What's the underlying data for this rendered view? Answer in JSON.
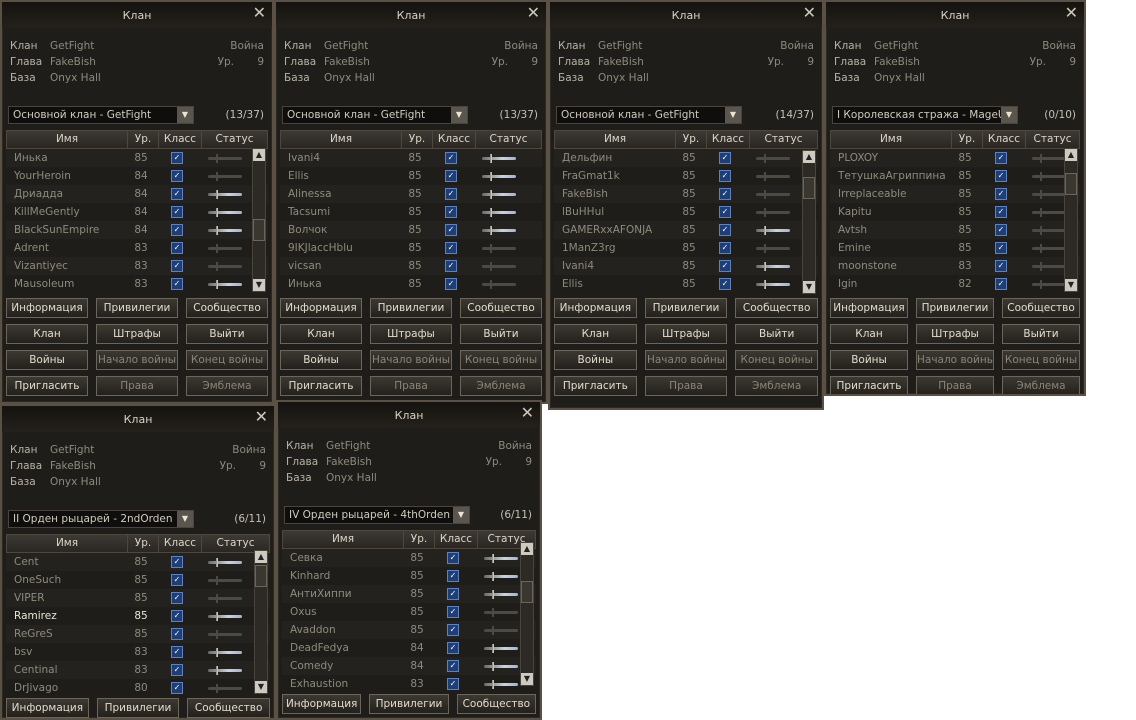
{
  "panels": [
    {
      "title": "Клан",
      "info": {
        "clan_k": "Клан",
        "clan_v": "GetFight",
        "war": "Война",
        "leader_k": "Глава",
        "leader_v": "FakeBish",
        "lvl_k": "Ур.",
        "lvl_v": "9",
        "base_k": "База",
        "base_v": "Onyx Hall"
      },
      "select": "Основной клан - GetFight",
      "count": "(13/37)",
      "headers": [
        "Имя",
        "Ур.",
        "Класс",
        "Статус"
      ],
      "rows": [
        {
          "name": "Инька",
          "lvl": "85",
          "on": false
        },
        {
          "name": "YourHeroin",
          "lvl": "84",
          "on": false
        },
        {
          "name": "Дриадда",
          "lvl": "84",
          "on": true
        },
        {
          "name": "KillMeGently",
          "lvl": "84",
          "on": true
        },
        {
          "name": "BlackSunEmpire",
          "lvl": "84",
          "on": true
        },
        {
          "name": "Adrent",
          "lvl": "83",
          "on": false
        },
        {
          "name": "Vizantiyec",
          "lvl": "83",
          "on": false
        },
        {
          "name": "Mausoleum",
          "lvl": "83",
          "on": true
        }
      ],
      "buttons": [
        {
          "label": "Информация",
          "dis": false
        },
        {
          "label": "Привилегии",
          "dis": false
        },
        {
          "label": "Сообщество",
          "dis": false
        },
        {
          "label": "Клан",
          "dis": false
        },
        {
          "label": "Штрафы",
          "dis": false
        },
        {
          "label": "Выйти",
          "dis": false
        },
        {
          "label": "Войны",
          "dis": false
        },
        {
          "label": "Начало войны",
          "dis": true
        },
        {
          "label": "Конец войны",
          "dis": true
        },
        {
          "label": "Пригласить",
          "dis": false
        },
        {
          "label": "Права",
          "dis": true
        },
        {
          "label": "Эмблема",
          "dis": true
        }
      ]
    },
    {
      "title": "Клан",
      "info": {
        "clan_k": "Клан",
        "clan_v": "GetFight",
        "war": "Война",
        "leader_k": "Глава",
        "leader_v": "FakeBish",
        "lvl_k": "Ур.",
        "lvl_v": "9",
        "base_k": "База",
        "base_v": "Onyx Hall"
      },
      "select": "Основной клан - GetFight",
      "count": "(13/37)",
      "headers": [
        "Имя",
        "Ур.",
        "Класс",
        "Статус"
      ],
      "rows": [
        {
          "name": "Ivani4",
          "lvl": "85",
          "on": true
        },
        {
          "name": "Ellis",
          "lvl": "85",
          "on": true
        },
        {
          "name": "Alinessa",
          "lvl": "85",
          "on": true
        },
        {
          "name": "Tacsumi",
          "lvl": "85",
          "on": true
        },
        {
          "name": "Волчок",
          "lvl": "85",
          "on": true
        },
        {
          "name": "9IKJlaccHblu",
          "lvl": "85",
          "on": false
        },
        {
          "name": "vicsan",
          "lvl": "85",
          "on": false
        },
        {
          "name": "Инька",
          "lvl": "85",
          "on": false
        }
      ],
      "buttons": [
        {
          "label": "Информация",
          "dis": false
        },
        {
          "label": "Привилегии",
          "dis": false
        },
        {
          "label": "Сообщество",
          "dis": false
        },
        {
          "label": "Клан",
          "dis": false
        },
        {
          "label": "Штрафы",
          "dis": false
        },
        {
          "label": "Выйти",
          "dis": false
        },
        {
          "label": "Войны",
          "dis": false
        },
        {
          "label": "Начало войны",
          "dis": true
        },
        {
          "label": "Конец войны",
          "dis": true
        },
        {
          "label": "Пригласить",
          "dis": false
        },
        {
          "label": "Права",
          "dis": true
        },
        {
          "label": "Эмблема",
          "dis": true
        }
      ]
    },
    {
      "title": "Клан",
      "info": {
        "clan_k": "Клан",
        "clan_v": "GetFight",
        "war": "Война",
        "leader_k": "Глава",
        "leader_v": "FakeBish",
        "lvl_k": "Ур.",
        "lvl_v": "9",
        "base_k": "База",
        "base_v": "Onyx Hall"
      },
      "select": "Основной клан - GetFight",
      "count": "(14/37)",
      "headers": [
        "Имя",
        "Ур.",
        "Класс",
        "Статус"
      ],
      "rows": [
        {
          "name": "Дельфин",
          "lvl": "85",
          "on": false
        },
        {
          "name": "FraGmat1k",
          "lvl": "85",
          "on": false
        },
        {
          "name": "FakeBish",
          "lvl": "85",
          "on": false
        },
        {
          "name": "lBuHHul",
          "lvl": "85",
          "on": false
        },
        {
          "name": "GAMERxxAFONJA",
          "lvl": "85",
          "on": true
        },
        {
          "name": "1ManZ3rg",
          "lvl": "85",
          "on": false
        },
        {
          "name": "Ivani4",
          "lvl": "85",
          "on": true
        },
        {
          "name": "Ellis",
          "lvl": "85",
          "on": true
        }
      ],
      "buttons": [
        {
          "label": "Информация",
          "dis": false
        },
        {
          "label": "Привилегии",
          "dis": false
        },
        {
          "label": "Сообщество",
          "dis": false
        },
        {
          "label": "Клан",
          "dis": false
        },
        {
          "label": "Штрафы",
          "dis": false
        },
        {
          "label": "Выйти",
          "dis": false
        },
        {
          "label": "Войны",
          "dis": false
        },
        {
          "label": "Начало войны",
          "dis": true
        },
        {
          "label": "Конец войны",
          "dis": true
        },
        {
          "label": "Пригласить",
          "dis": false
        },
        {
          "label": "Права",
          "dis": true
        },
        {
          "label": "Эмблема",
          "dis": true
        }
      ]
    },
    {
      "title": "Клан",
      "info": {
        "clan_k": "Клан",
        "clan_v": "GetFight",
        "war": "Война",
        "leader_k": "Глава",
        "leader_v": "FakeBish",
        "lvl_k": "Ур.",
        "lvl_v": "9",
        "base_k": "База",
        "base_v": "Onyx Hall"
      },
      "select": "I Королевская стража - MageUr",
      "count": "(0/10)",
      "headers": [
        "Имя",
        "Ур.",
        "Класс",
        "Статус"
      ],
      "rows": [
        {
          "name": "PLOXOY",
          "lvl": "85",
          "on": false
        },
        {
          "name": "ТетушкаАгриппина",
          "lvl": "85",
          "on": false
        },
        {
          "name": "Irreplaceable",
          "lvl": "85",
          "on": false
        },
        {
          "name": "Kapitu",
          "lvl": "85",
          "on": false
        },
        {
          "name": "Avtsh",
          "lvl": "85",
          "on": false
        },
        {
          "name": "Emine",
          "lvl": "85",
          "on": false
        },
        {
          "name": "moonstone",
          "lvl": "83",
          "on": false
        },
        {
          "name": "Igin",
          "lvl": "82",
          "on": false
        }
      ],
      "buttons": [
        {
          "label": "Информация",
          "dis": false
        },
        {
          "label": "Привилегии",
          "dis": false
        },
        {
          "label": "Сообщество",
          "dis": false
        },
        {
          "label": "Клан",
          "dis": false
        },
        {
          "label": "Штрафы",
          "dis": false
        },
        {
          "label": "Выйти",
          "dis": false
        },
        {
          "label": "Войны",
          "dis": false
        },
        {
          "label": "Начало войны",
          "dis": true
        },
        {
          "label": "Конец войны",
          "dis": true
        },
        {
          "label": "Пригласить",
          "dis": false
        },
        {
          "label": "Права",
          "dis": true
        },
        {
          "label": "Эмблема",
          "dis": true
        }
      ]
    },
    {
      "title": "Клан",
      "info": {
        "clan_k": "Клан",
        "clan_v": "GetFight",
        "war": "Война",
        "leader_k": "Глава",
        "leader_v": "FakeBish",
        "lvl_k": "Ур.",
        "lvl_v": "9",
        "base_k": "База",
        "base_v": "Onyx Hall"
      },
      "select": "II Орден рыцарей - 2ndOrden",
      "count": "(6/11)",
      "headers": [
        "Имя",
        "Ур.",
        "Класс",
        "Статус"
      ],
      "rows": [
        {
          "name": "Cent",
          "lvl": "85",
          "on": true
        },
        {
          "name": "OneSuch",
          "lvl": "85",
          "on": false
        },
        {
          "name": "VIPER",
          "lvl": "85",
          "on": false
        },
        {
          "name": "Ramirez",
          "lvl": "85",
          "on": true,
          "hl": true
        },
        {
          "name": "ReGreS",
          "lvl": "85",
          "on": false
        },
        {
          "name": "bsv",
          "lvl": "83",
          "on": true
        },
        {
          "name": "Centinal",
          "lvl": "83",
          "on": true
        },
        {
          "name": "DrJivago",
          "lvl": "80",
          "on": false
        }
      ],
      "buttons": [
        {
          "label": "Информация",
          "dis": false
        },
        {
          "label": "Привилегии",
          "dis": false
        },
        {
          "label": "Сообщество",
          "dis": false
        }
      ]
    },
    {
      "title": "Клан",
      "info": {
        "clan_k": "Клан",
        "clan_v": "GetFight",
        "war": "Война",
        "leader_k": "Глава",
        "leader_v": "FakeBish",
        "lvl_k": "Ур.",
        "lvl_v": "9",
        "base_k": "База",
        "base_v": "Onyx Hall"
      },
      "select": "IV Орден рыцарей - 4thOrden",
      "count": "(6/11)",
      "headers": [
        "Имя",
        "Ур.",
        "Класс",
        "Статус"
      ],
      "rows": [
        {
          "name": "Севка",
          "lvl": "85",
          "on": true
        },
        {
          "name": "Kinhard",
          "lvl": "85",
          "on": true
        },
        {
          "name": "АнтиХиппи",
          "lvl": "85",
          "on": true
        },
        {
          "name": "Oxus",
          "lvl": "85",
          "on": false
        },
        {
          "name": "Avaddon",
          "lvl": "85",
          "on": false
        },
        {
          "name": "DeadFedya",
          "lvl": "84",
          "on": true
        },
        {
          "name": "Comedy",
          "lvl": "84",
          "on": true
        },
        {
          "name": "Exhaustion",
          "lvl": "83",
          "on": true
        }
      ],
      "buttons": [
        {
          "label": "Информация",
          "dis": false
        },
        {
          "label": "Привилегии",
          "dis": false
        },
        {
          "label": "Сообщество",
          "dis": false
        }
      ]
    }
  ]
}
